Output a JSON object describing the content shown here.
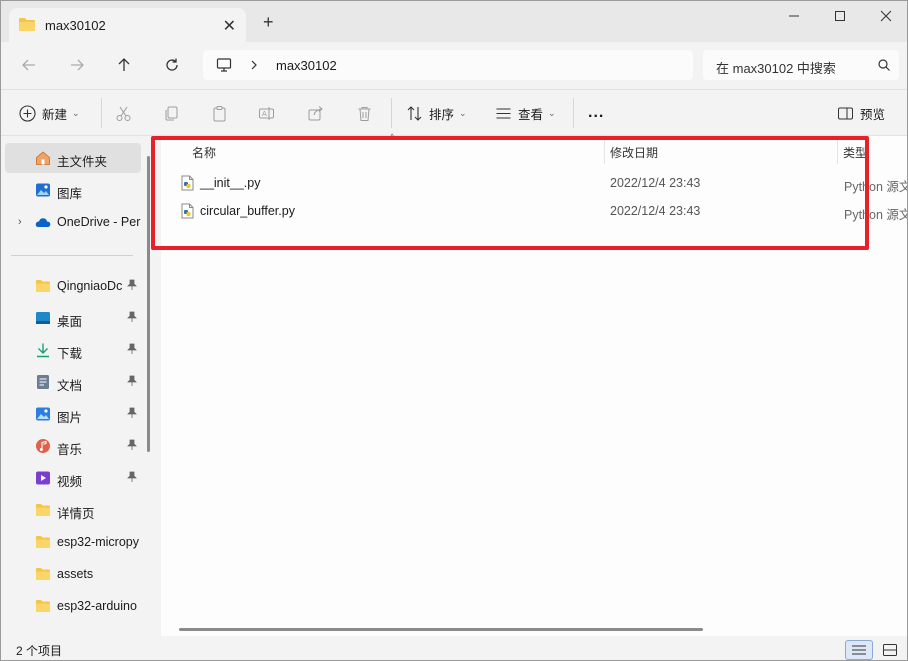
{
  "tab": {
    "title": "max30102",
    "icon": "folder-icon"
  },
  "window_controls": {
    "minimize": "minimize-icon",
    "maximize": "maximize-icon",
    "close": "close-icon"
  },
  "address": {
    "path": "max30102",
    "icon": "computer-icon"
  },
  "search": {
    "placeholder": "在 max30102 中搜索"
  },
  "commands": {
    "new_label": "新建",
    "sort_label": "排序",
    "view_label": "查看",
    "preview_label": "预览",
    "more": "..."
  },
  "sidebar": {
    "items": [
      {
        "label": "主文件夹",
        "icon": "home-icon",
        "pinned": false,
        "selected": true
      },
      {
        "label": "图库",
        "icon": "gallery-icon",
        "pinned": false
      },
      {
        "label": "OneDrive - Per",
        "icon": "cloud-icon",
        "pinned": false,
        "expandable": true
      },
      {
        "label": "QingniaoDc",
        "icon": "folder-icon",
        "pinned": true
      },
      {
        "label": "桌面",
        "icon": "desktop-icon",
        "pinned": true
      },
      {
        "label": "下载",
        "icon": "download-icon",
        "pinned": true
      },
      {
        "label": "文档",
        "icon": "document-icon",
        "pinned": true
      },
      {
        "label": "图片",
        "icon": "pictures-icon",
        "pinned": true
      },
      {
        "label": "音乐",
        "icon": "music-icon",
        "pinned": true
      },
      {
        "label": "视频",
        "icon": "video-icon",
        "pinned": true
      },
      {
        "label": "详情页",
        "icon": "folder-icon",
        "pinned": false
      },
      {
        "label": "esp32-micropy",
        "icon": "folder-icon",
        "pinned": false
      },
      {
        "label": "assets",
        "icon": "folder-icon",
        "pinned": false
      },
      {
        "label": "esp32-arduino",
        "icon": "folder-icon",
        "pinned": false
      }
    ]
  },
  "columns": {
    "name": "名称",
    "modified": "修改日期",
    "type": "类型"
  },
  "files": [
    {
      "name": "__init__.py",
      "modified": "2022/12/4 23:43",
      "type": "Python 源文"
    },
    {
      "name": "circular_buffer.py",
      "modified": "2022/12/4 23:43",
      "type": "Python 源文"
    }
  ],
  "status": {
    "count": "2 个项目"
  },
  "colors": {
    "highlight": "#e8202a",
    "folder": "#f4c54a",
    "selected_bg": "#e0e0e0"
  }
}
